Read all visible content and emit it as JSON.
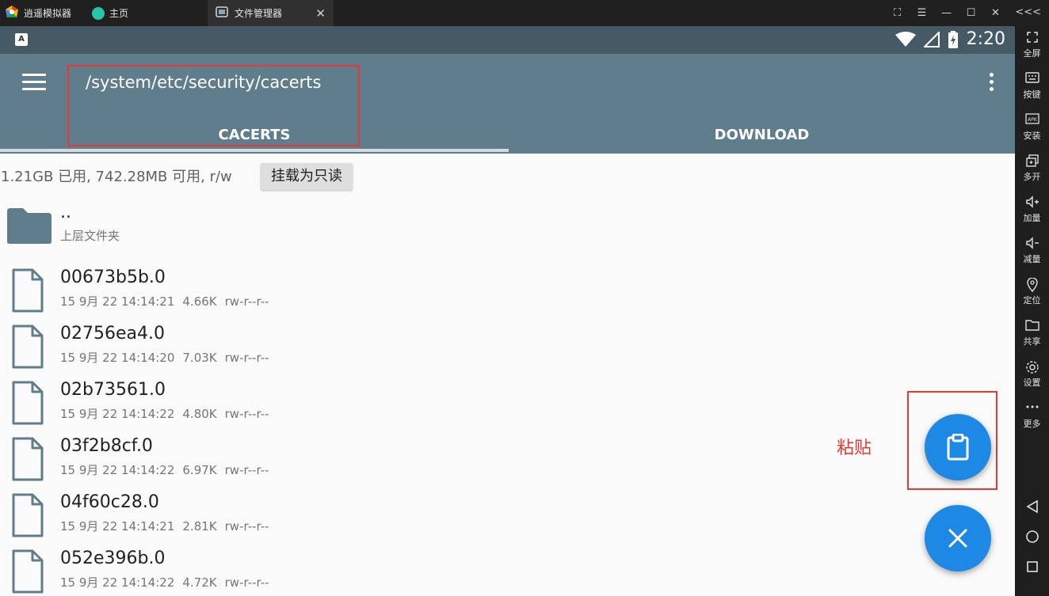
{
  "window": {
    "tabs": [
      {
        "label": "逍遥模拟器",
        "icon": "emulator-logo-icon"
      },
      {
        "label": "主页",
        "icon": "home-app-icon"
      },
      {
        "label": "文件管理器",
        "icon": "file-manager-icon",
        "active": true
      }
    ],
    "controls": [
      "screenshot-icon",
      "menu-icon",
      "minimize-icon",
      "maximize-icon",
      "close-icon"
    ]
  },
  "statusbar": {
    "time": "2:20",
    "notification_icon": "A"
  },
  "appbar": {
    "path": "/system/etc/security/cacerts",
    "tabs": [
      {
        "label": "CACERTS",
        "active": true
      },
      {
        "label": "DOWNLOAD",
        "active": false
      }
    ],
    "colors": {
      "primary": "#607d8b",
      "status": "#455a64"
    }
  },
  "storage": {
    "info": "1.21GB 已用, 742.28MB 可用, r/w",
    "mount_button": "挂载为只读"
  },
  "parent": {
    "name": "..",
    "subtitle": "上层文件夹"
  },
  "files": [
    {
      "name": "00673b5b.0",
      "date": "15 9月 22 14:14:21",
      "size": "4.66K",
      "perm": "rw-r--r--"
    },
    {
      "name": "02756ea4.0",
      "date": "15 9月 22 14:14:20",
      "size": "7.03K",
      "perm": "rw-r--r--"
    },
    {
      "name": "02b73561.0",
      "date": "15 9月 22 14:14:22",
      "size": "4.80K",
      "perm": "rw-r--r--"
    },
    {
      "name": "03f2b8cf.0",
      "date": "15 9月 22 14:14:22",
      "size": "6.97K",
      "perm": "rw-r--r--"
    },
    {
      "name": "04f60c28.0",
      "date": "15 9月 22 14:14:21",
      "size": "2.81K",
      "perm": "rw-r--r--"
    },
    {
      "name": "052e396b.0",
      "date": "15 9月 22 14:14:22",
      "size": "4.72K",
      "perm": "rw-r--r--"
    }
  ],
  "fab": {
    "paste_label": "粘贴",
    "accent": "#1e88e5",
    "annotation_color": "#e53935"
  },
  "sidebar": {
    "collapse": "<<<",
    "items": [
      {
        "label": "全屏",
        "icon": "fullscreen-icon"
      },
      {
        "label": "按键",
        "icon": "keyboard-icon"
      },
      {
        "label": "安装",
        "icon": "apk-install-icon"
      },
      {
        "label": "多开",
        "icon": "multi-instance-icon"
      },
      {
        "label": "加量",
        "icon": "volume-up-icon"
      },
      {
        "label": "减量",
        "icon": "volume-down-icon"
      },
      {
        "label": "定位",
        "icon": "location-icon"
      },
      {
        "label": "共享",
        "icon": "shared-folder-icon"
      },
      {
        "label": "设置",
        "icon": "settings-icon"
      },
      {
        "label": "更多",
        "icon": "more-icon"
      }
    ]
  }
}
